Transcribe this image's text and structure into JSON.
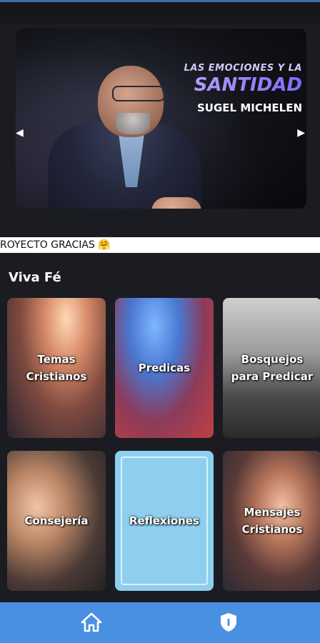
{
  "banner": {
    "title_line1": "LAS EMOCIONES Y LA",
    "title_line2": "SANTIDAD",
    "speaker": "SUGEL MICHELEN",
    "prev_icon": "triangle-left-icon",
    "next_icon": "triangle-right-icon"
  },
  "marquee": {
    "text": "ROYECTO GRACIAS 🤗"
  },
  "section": {
    "title": "Viva Fé"
  },
  "tiles": [
    {
      "label": "Temas Cristianos"
    },
    {
      "label": "Predicas"
    },
    {
      "label": "Bosquejos para Predicar"
    },
    {
      "label": "Consejería"
    },
    {
      "label": "Reflexiones"
    },
    {
      "label": "Mensajes Cristianos"
    }
  ],
  "nav": {
    "items": [
      {
        "icon": "home-icon"
      },
      {
        "icon": "shield-icon"
      }
    ]
  },
  "colors": {
    "background": "#1b1c21",
    "nav_bar": "#4a90e2",
    "accent_purple": "#7e6bff"
  }
}
